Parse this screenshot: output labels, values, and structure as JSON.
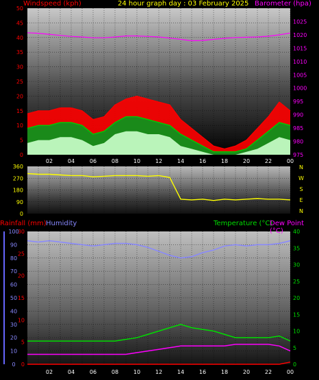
{
  "title": "24 hour graph day : 03 February 2025",
  "colors": {
    "wind": "#ff0000",
    "gust": "#ff0000",
    "avg_wind": "#00cc00",
    "baro": "#ff00ff",
    "dir": "#ffff00",
    "rain": "#ff0000",
    "humidity": "#8888ff",
    "temp": "#00dd00",
    "dew": "#ff00ff",
    "rain_tick": "#ffaa00"
  },
  "chart_data": [
    {
      "type": "line",
      "name": "wind-baro",
      "ylabel_left": "Windspeed (kph)",
      "ylabel_right": "Barometer (hpa)",
      "ylim_left": [
        0,
        50
      ],
      "ylim_right": [
        975,
        1030
      ],
      "y_ticks_left": [
        "0",
        "5",
        "10",
        "15",
        "20",
        "25",
        "30",
        "35",
        "40",
        "45",
        "50"
      ],
      "y_ticks_right": [
        "975",
        "980",
        "985",
        "990",
        "995",
        "1000",
        "1005",
        "1010",
        "1015",
        "1020",
        "1025"
      ],
      "x_ticks": [
        "02",
        "04",
        "06",
        "08",
        "10",
        "12",
        "14",
        "16",
        "18",
        "20",
        "22",
        "00"
      ],
      "x_hours": [
        0,
        1,
        2,
        3,
        4,
        5,
        6,
        7,
        8,
        9,
        10,
        11,
        12,
        13,
        14,
        15,
        16,
        17,
        18,
        19,
        20,
        21,
        22,
        23,
        24
      ],
      "series": [
        {
          "key": "gust",
          "values": [
            14,
            15,
            15,
            16,
            16,
            15,
            12,
            13,
            17,
            19,
            20,
            19,
            18,
            17,
            12,
            9,
            6,
            3,
            2,
            3,
            5,
            9,
            13,
            18,
            15
          ]
        },
        {
          "key": "avg_wind",
          "values": [
            9,
            10,
            10,
            11,
            11,
            10,
            7,
            8,
            11,
            13,
            13,
            12,
            11,
            10,
            7,
            5,
            3,
            1,
            1,
            1,
            2,
            5,
            8,
            11,
            10
          ]
        },
        {
          "key": "low_wind",
          "values": [
            4,
            5,
            5,
            6,
            6,
            5,
            3,
            4,
            7,
            8,
            8,
            7,
            7,
            6,
            3,
            2,
            1,
            0,
            0,
            0,
            1,
            2,
            4,
            6,
            5
          ]
        },
        {
          "key": "baro",
          "values": [
            1020.8,
            1020.6,
            1020.2,
            1019.8,
            1019.4,
            1019.2,
            1018.9,
            1018.9,
            1019.2,
            1019.6,
            1019.6,
            1019.4,
            1019.2,
            1018.8,
            1018.3,
            1017.8,
            1017.9,
            1018.3,
            1018.7,
            1019.0,
            1019.1,
            1019.2,
            1019.5,
            1020.0,
            1020.7
          ]
        }
      ]
    },
    {
      "type": "line",
      "name": "wind-direction",
      "y_ticks_left": [
        "0",
        "90",
        "180",
        "270",
        "360"
      ],
      "ylim_left": [
        0,
        360
      ],
      "compass": [
        "N",
        "W",
        "S",
        "E",
        "N"
      ],
      "x_hours": [
        0,
        1,
        2,
        3,
        4,
        5,
        6,
        7,
        8,
        9,
        10,
        11,
        12,
        13,
        14,
        15,
        16,
        17,
        18,
        19,
        20,
        21,
        22,
        23,
        24
      ],
      "series": [
        {
          "key": "dir",
          "values": [
            305,
            300,
            300,
            295,
            290,
            290,
            280,
            285,
            290,
            290,
            290,
            285,
            290,
            275,
            110,
            105,
            110,
            100,
            110,
            105,
            110,
            115,
            110,
            110,
            105
          ]
        }
      ]
    },
    {
      "type": "line",
      "name": "rain-humidity-temp",
      "ylabel_rain": "Rainfall (mm)",
      "ylabel_humidity": "Humidity",
      "ylabel_temp": "Temperature (°C)",
      "ylabel_dew": "Dew Point (°C)",
      "ylim_humidity": [
        0,
        100
      ],
      "ylim_rain": [
        0,
        30
      ],
      "ylim_temp": [
        0,
        40
      ],
      "y_ticks_humidity": [
        "0",
        "10",
        "20",
        "30",
        "40",
        "50",
        "60",
        "70",
        "80",
        "90",
        "100"
      ],
      "y_ticks_rain": [
        "0",
        "5",
        "10",
        "15",
        "20",
        "25",
        "30"
      ],
      "y_ticks_temp": [
        "0",
        "5",
        "10",
        "15",
        "20",
        "25",
        "30",
        "35",
        "40"
      ],
      "x_ticks": [
        "02",
        "04",
        "06",
        "08",
        "10",
        "12",
        "14",
        "16",
        "18",
        "20",
        "22",
        "00"
      ],
      "x_hours": [
        0,
        1,
        2,
        3,
        4,
        5,
        6,
        7,
        8,
        9,
        10,
        11,
        12,
        13,
        14,
        15,
        16,
        17,
        18,
        19,
        20,
        21,
        22,
        23,
        24
      ],
      "series": [
        {
          "key": "humidity",
          "values": [
            93,
            92,
            93,
            92,
            91,
            90,
            89,
            90,
            91,
            91,
            90,
            88,
            85,
            82,
            80,
            81,
            84,
            86,
            89,
            90,
            89,
            90,
            90,
            91,
            93
          ]
        },
        {
          "key": "temp",
          "values": [
            7,
            7,
            7,
            7,
            7,
            7,
            7,
            7,
            7,
            7.5,
            8,
            9,
            10,
            11,
            12,
            11,
            10.5,
            10,
            9,
            8,
            8,
            8,
            8,
            8.5,
            7
          ]
        },
        {
          "key": "dew",
          "values": [
            3,
            3,
            3,
            3,
            3,
            3,
            3,
            3,
            3,
            3,
            3.5,
            4,
            4.5,
            5,
            5.5,
            5.5,
            5.5,
            5.5,
            5.5,
            6,
            6,
            6,
            6,
            5.5,
            4
          ]
        },
        {
          "key": "rain",
          "values": [
            0,
            0,
            0,
            0,
            0,
            0,
            0,
            0,
            0,
            0,
            0,
            0,
            0,
            0,
            0,
            0,
            0,
            0,
            0,
            0,
            0,
            0,
            0,
            0,
            0.5
          ]
        }
      ]
    }
  ]
}
